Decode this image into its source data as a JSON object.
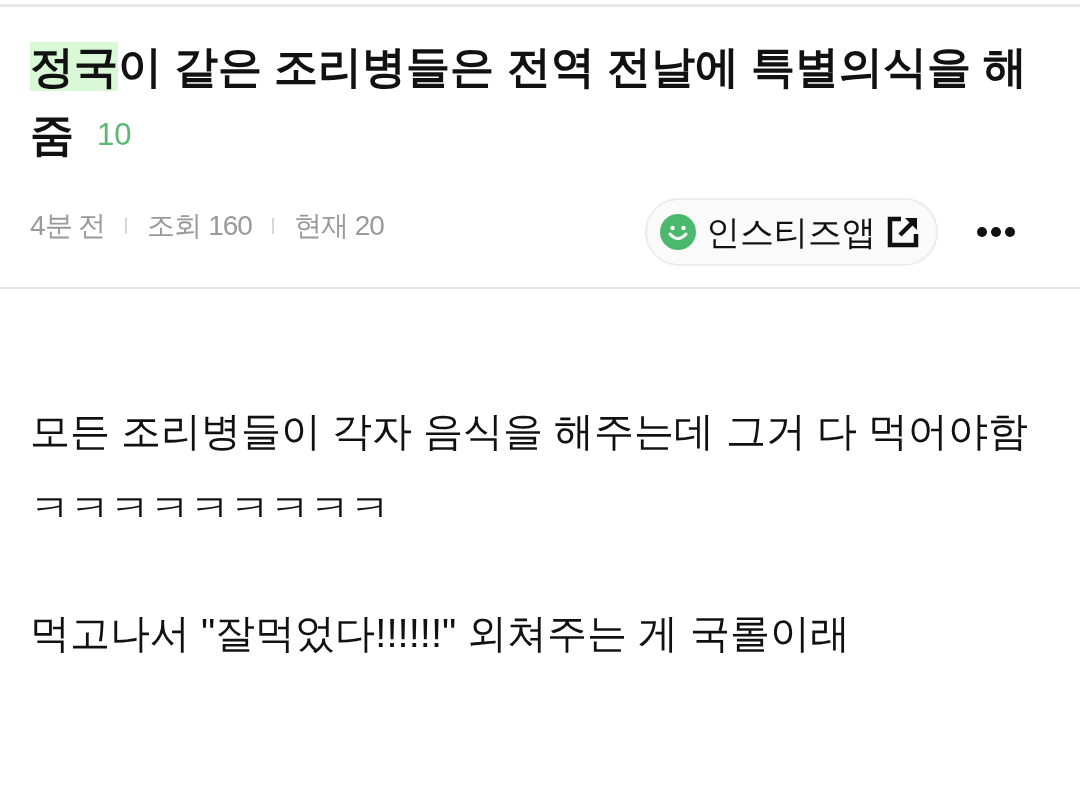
{
  "title": {
    "parts": [
      {
        "text": "정국",
        "highlighted": true
      },
      {
        "text": "이 같은 조리병들은 전역 전날에 특별의식을 해 줌",
        "highlighted": false
      }
    ],
    "comment_count": "10"
  },
  "meta": [
    "4분 전",
    "조회 160",
    "현재 20"
  ],
  "app_button": {
    "label": "인스티즈앱"
  },
  "body": {
    "paragraphs": [
      {
        "lines": [
          "모든 조리병들이 각자 음식을 해주는데 그거 다 먹어야함",
          "ㅋㅋㅋㅋㅋㅋㅋㅋㅋ"
        ]
      },
      {
        "lines": [
          "먹고나서 \"잘먹었다!!!!!!\" 외쳐주는 게 국롤이래"
        ]
      }
    ]
  }
}
